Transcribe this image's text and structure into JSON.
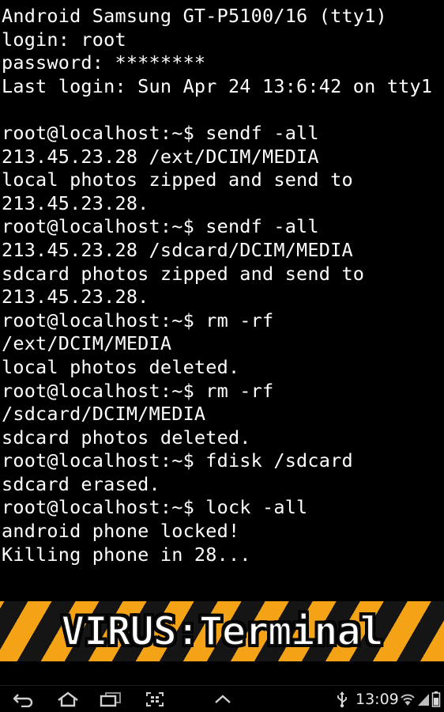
{
  "terminal": {
    "lines": [
      "Android Samsung GT-P5100/16 (tty1)",
      "login: root",
      "password: ********",
      "Last login: Sun Apr 24 13:6:42 on tty1",
      "",
      "root@localhost:~$ sendf -all",
      "213.45.23.28 /ext/DCIM/MEDIA",
      "local photos zipped and send to",
      "213.45.23.28.",
      "root@localhost:~$ sendf -all",
      "213.45.23.28 /sdcard/DCIM/MEDIA",
      "sdcard photos zipped and send to",
      "213.45.23.28.",
      "root@localhost:~$ rm -rf",
      "/ext/DCIM/MEDIA",
      "local photos deleted.",
      "root@localhost:~$ rm -rf",
      "/sdcard/DCIM/MEDIA",
      "sdcard photos deleted.",
      "root@localhost:~$ fdisk /sdcard",
      "sdcard erased.",
      "root@localhost:~$ lock -all",
      "android phone locked!",
      "Killing phone in 28..."
    ],
    "text_color": "#ffffff",
    "background_color": "#000000"
  },
  "banner": {
    "title": "VIRUS:Terminal",
    "stripe_colors": [
      "#f5a316",
      "#151515"
    ]
  },
  "navigation_bar": {
    "buttons": [
      "back-icon",
      "home-icon",
      "recent-apps-icon",
      "screenshot-icon",
      "chevron-up-icon"
    ]
  },
  "status_bar": {
    "time": "13:09",
    "icons": [
      "usb-icon",
      "wifi-icon",
      "signal-icon",
      "battery-icon"
    ]
  }
}
